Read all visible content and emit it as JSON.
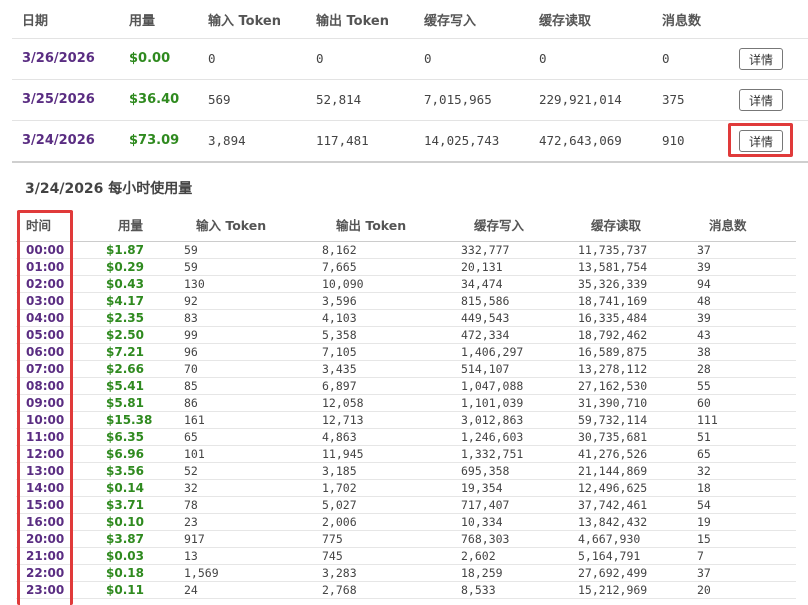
{
  "daily_table": {
    "headers": [
      "日期",
      "用量",
      "输入 Token",
      "输出 Token",
      "缓存写入",
      "缓存读取",
      "消息数"
    ],
    "rows": [
      {
        "date": "3/26/2026",
        "cost": "$0.00",
        "input": "0",
        "output": "0",
        "cache_write": "0",
        "cache_read": "0",
        "messages": "0",
        "action": "详情"
      },
      {
        "date": "3/25/2026",
        "cost": "$36.40",
        "input": "569",
        "output": "52,814",
        "cache_write": "7,015,965",
        "cache_read": "229,921,014",
        "messages": "375",
        "action": "详情"
      },
      {
        "date": "3/24/2026",
        "cost": "$73.09",
        "input": "3,894",
        "output": "117,481",
        "cache_write": "14,025,743",
        "cache_read": "472,643,069",
        "messages": "910",
        "action": "详情"
      }
    ]
  },
  "hourly": {
    "title": "3/24/2026 每小时使用量",
    "headers": [
      "时间",
      "用量",
      "输入 Token",
      "输出 Token",
      "缓存写入",
      "缓存读取",
      "消息数"
    ],
    "rows": [
      {
        "time": "00:00",
        "cost": "$1.87",
        "input": "59",
        "output": "8,162",
        "cache_write": "332,777",
        "cache_read": "11,735,737",
        "messages": "37"
      },
      {
        "time": "01:00",
        "cost": "$0.29",
        "input": "59",
        "output": "7,665",
        "cache_write": "20,131",
        "cache_read": "13,581,754",
        "messages": "39"
      },
      {
        "time": "02:00",
        "cost": "$0.43",
        "input": "130",
        "output": "10,090",
        "cache_write": "34,474",
        "cache_read": "35,326,339",
        "messages": "94"
      },
      {
        "time": "03:00",
        "cost": "$4.17",
        "input": "92",
        "output": "3,596",
        "cache_write": "815,586",
        "cache_read": "18,741,169",
        "messages": "48"
      },
      {
        "time": "04:00",
        "cost": "$2.35",
        "input": "83",
        "output": "4,103",
        "cache_write": "449,543",
        "cache_read": "16,335,484",
        "messages": "39"
      },
      {
        "time": "05:00",
        "cost": "$2.50",
        "input": "99",
        "output": "5,358",
        "cache_write": "472,334",
        "cache_read": "18,792,462",
        "messages": "43"
      },
      {
        "time": "06:00",
        "cost": "$7.21",
        "input": "96",
        "output": "7,105",
        "cache_write": "1,406,297",
        "cache_read": "16,589,875",
        "messages": "38"
      },
      {
        "time": "07:00",
        "cost": "$2.66",
        "input": "70",
        "output": "3,435",
        "cache_write": "514,107",
        "cache_read": "13,278,112",
        "messages": "28"
      },
      {
        "time": "08:00",
        "cost": "$5.41",
        "input": "85",
        "output": "6,897",
        "cache_write": "1,047,088",
        "cache_read": "27,162,530",
        "messages": "55"
      },
      {
        "time": "09:00",
        "cost": "$5.81",
        "input": "86",
        "output": "12,058",
        "cache_write": "1,101,039",
        "cache_read": "31,390,710",
        "messages": "60"
      },
      {
        "time": "10:00",
        "cost": "$15.38",
        "input": "161",
        "output": "12,713",
        "cache_write": "3,012,863",
        "cache_read": "59,732,114",
        "messages": "111"
      },
      {
        "time": "11:00",
        "cost": "$6.35",
        "input": "65",
        "output": "4,863",
        "cache_write": "1,246,603",
        "cache_read": "30,735,681",
        "messages": "51"
      },
      {
        "time": "12:00",
        "cost": "$6.96",
        "input": "101",
        "output": "11,945",
        "cache_write": "1,332,751",
        "cache_read": "41,276,526",
        "messages": "65"
      },
      {
        "time": "13:00",
        "cost": "$3.56",
        "input": "52",
        "output": "3,185",
        "cache_write": "695,358",
        "cache_read": "21,144,869",
        "messages": "32"
      },
      {
        "time": "14:00",
        "cost": "$0.14",
        "input": "32",
        "output": "1,702",
        "cache_write": "19,354",
        "cache_read": "12,496,625",
        "messages": "18"
      },
      {
        "time": "15:00",
        "cost": "$3.71",
        "input": "78",
        "output": "5,027",
        "cache_write": "717,407",
        "cache_read": "37,742,461",
        "messages": "54"
      },
      {
        "time": "16:00",
        "cost": "$0.10",
        "input": "23",
        "output": "2,006",
        "cache_write": "10,334",
        "cache_read": "13,842,432",
        "messages": "19"
      },
      {
        "time": "20:00",
        "cost": "$3.87",
        "input": "917",
        "output": "775",
        "cache_write": "768,303",
        "cache_read": "4,667,930",
        "messages": "15"
      },
      {
        "time": "21:00",
        "cost": "$0.03",
        "input": "13",
        "output": "745",
        "cache_write": "2,602",
        "cache_read": "5,164,791",
        "messages": "7"
      },
      {
        "time": "22:00",
        "cost": "$0.18",
        "input": "1,569",
        "output": "3,283",
        "cache_write": "18,259",
        "cache_read": "27,692,499",
        "messages": "37"
      },
      {
        "time": "23:00",
        "cost": "$0.11",
        "input": "24",
        "output": "2,768",
        "cache_write": "8,533",
        "cache_read": "15,212,969",
        "messages": "20"
      }
    ]
  },
  "colors": {
    "date_text": "#5a2d82",
    "cost_text": "#2f8a1f",
    "highlight": "#e03a3a"
  }
}
